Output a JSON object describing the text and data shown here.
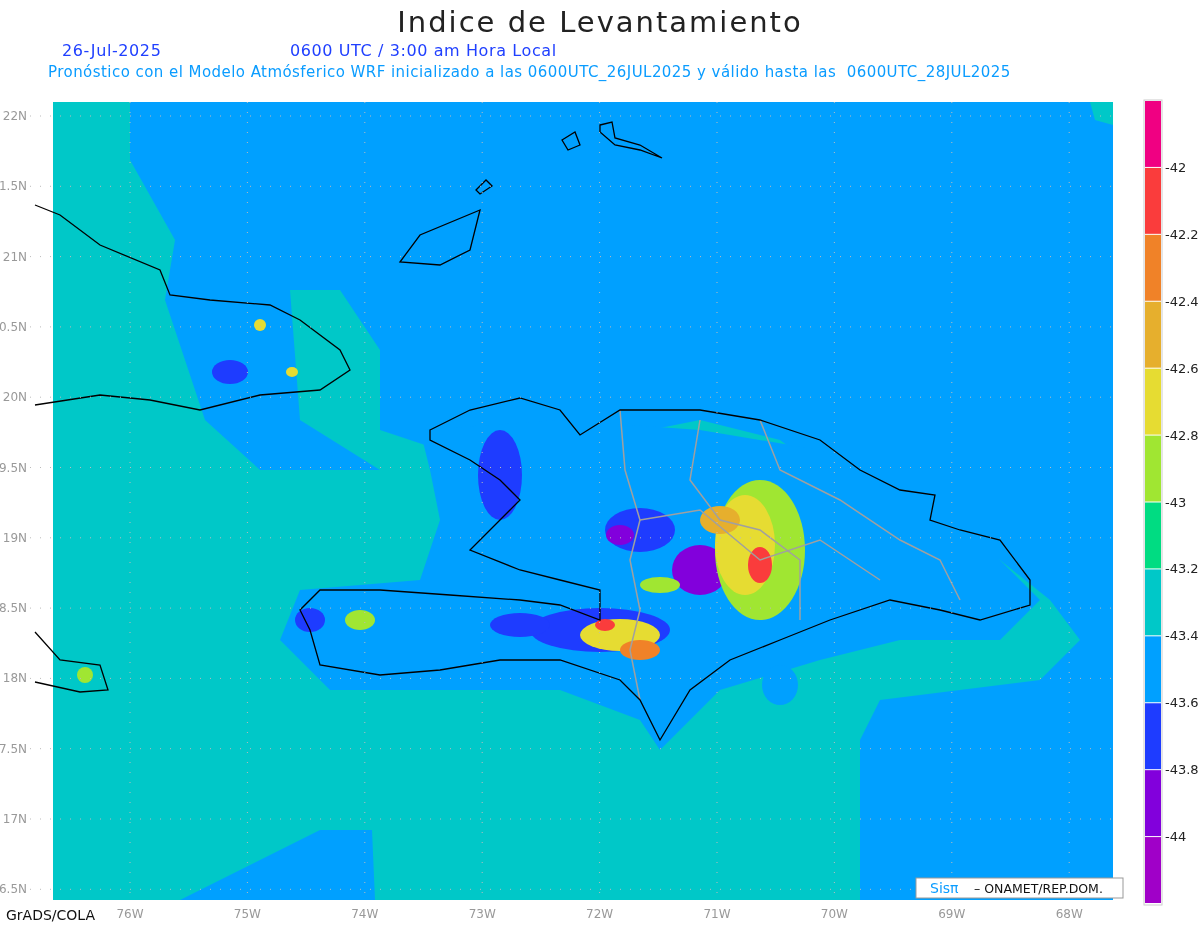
{
  "title": "Indice de Levantamiento",
  "date": "26-Jul-2025",
  "time": "0600 UTC / 3:00 am Hora Local",
  "subtitle": "Pronóstico con el Modelo Atmósferico WRF inicializado a las 0600UTC_26JUL2025 y válido hasta las  0600UTC_28JUL2025",
  "lat_labels": [
    "22N",
    "1.5N",
    "21N",
    "0.5N",
    "20N",
    "9.5N",
    "19N",
    "8.5N",
    "18N",
    "7.5N",
    "17N",
    "6.5N"
  ],
  "lon_labels": [
    "76W",
    "75W",
    "74W",
    "73W",
    "72W",
    "71W",
    "70W",
    "69W",
    "68W"
  ],
  "legend": [
    {
      "color": "#f00082",
      "label": "-42"
    },
    {
      "color": "#fa3c3c",
      "label": "-42.2"
    },
    {
      "color": "#f08228",
      "label": "-42.4"
    },
    {
      "color": "#e6af2d",
      "label": "-42.6"
    },
    {
      "color": "#e6dc32",
      "label": "-42.8"
    },
    {
      "color": "#a0e632",
      "label": "-43"
    },
    {
      "color": "#00dc82",
      "label": "-43.2"
    },
    {
      "color": "#00c8c8",
      "label": "-43.4"
    },
    {
      "color": "#00a0ff",
      "label": "-43.6"
    },
    {
      "color": "#1e3cff",
      "label": "-43.8"
    },
    {
      "color": "#8200dc",
      "label": "-44"
    },
    {
      "color": "#a000c8"
    }
  ],
  "credit": {
    "brand": "Sisπ",
    "text": "– ONAMET/REP.DOM."
  },
  "footer": "GrADS/COLA"
}
